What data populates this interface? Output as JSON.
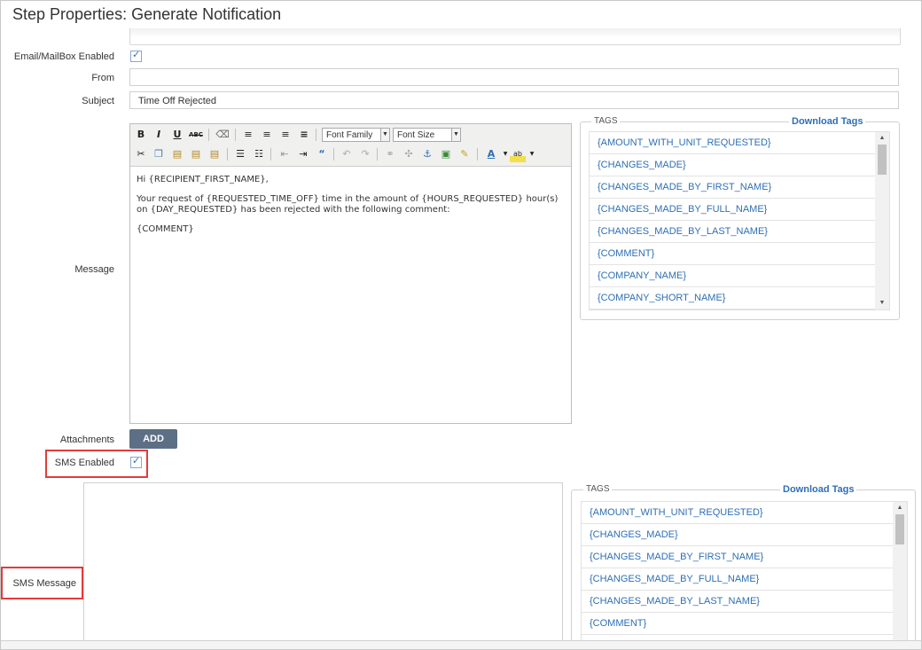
{
  "title": "Step Properties: Generate Notification",
  "labels": {
    "email_enabled": "Email/MailBox Enabled",
    "from": "From",
    "subject": "Subject",
    "message": "Message",
    "attachments": "Attachments",
    "sms_enabled": "SMS Enabled",
    "sms_message": "SMS Message"
  },
  "fields": {
    "email_enabled": true,
    "from_value": "",
    "subject_value": "Time Off Rejected",
    "sms_enabled": true,
    "sms_message_value": ""
  },
  "toolbar": {
    "font_family": "Font Family",
    "font_size": "Font Size"
  },
  "message_body": [
    "Hi {RECIPIENT_FIRST_NAME},",
    "Your request of {REQUESTED_TIME_OFF} time in the amount of {HOURS_REQUESTED} hour(s) on {DAY_REQUESTED} has been rejected with the following comment:",
    "{COMMENT}"
  ],
  "attachments": {
    "add_label": "ADD"
  },
  "tags_panel_1": {
    "heading": "TAGS",
    "download_label": "Download Tags",
    "items": [
      "{AMOUNT_WITH_UNIT_REQUESTED}",
      "{CHANGES_MADE}",
      "{CHANGES_MADE_BY_FIRST_NAME}",
      "{CHANGES_MADE_BY_FULL_NAME}",
      "{CHANGES_MADE_BY_LAST_NAME}",
      "{COMMENT}",
      "{COMPANY_NAME}",
      "{COMPANY_SHORT_NAME}"
    ]
  },
  "tags_panel_2": {
    "heading": "TAGS",
    "download_label": "Download Tags",
    "items": [
      "{AMOUNT_WITH_UNIT_REQUESTED}",
      "{CHANGES_MADE}",
      "{CHANGES_MADE_BY_FIRST_NAME}",
      "{CHANGES_MADE_BY_FULL_NAME}",
      "{CHANGES_MADE_BY_LAST_NAME}",
      "{COMMENT}"
    ]
  },
  "colors": {
    "link": "#2e6fb5",
    "highlight": "#e03c3c",
    "button": "#5c6f85"
  }
}
